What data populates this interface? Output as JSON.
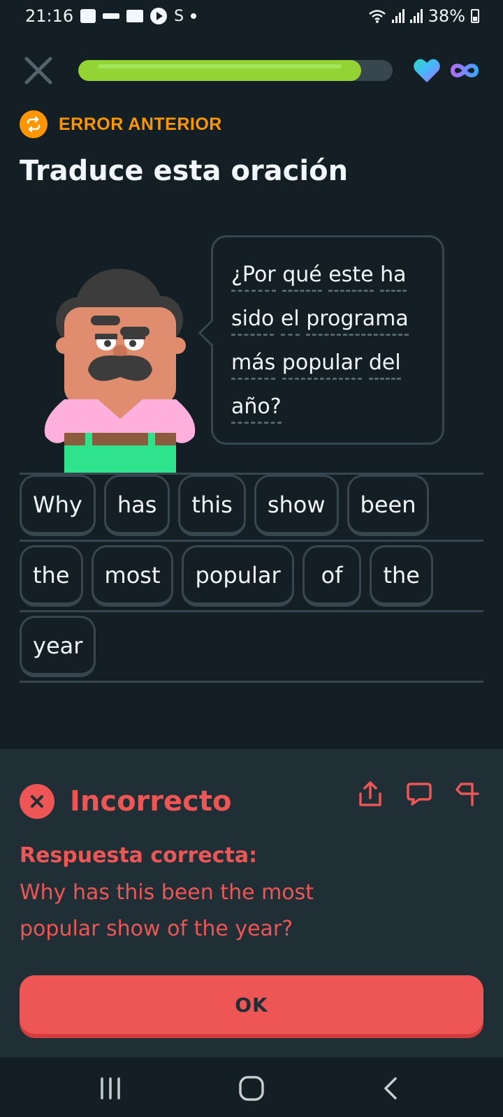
{
  "status_bar": {
    "time": "21:16",
    "battery": "38%",
    "icons": [
      "message-icon",
      "app-icon",
      "folder-icon",
      "play-icon",
      "shazam-icon",
      "dot-icon",
      "wifi-icon",
      "signal-icon",
      "battery-icon"
    ]
  },
  "lesson": {
    "progress": 0.9,
    "hearts": "heart-icon",
    "lives": "infinity-icon",
    "colors": {
      "progress": "#93d333",
      "track": "#37464f"
    }
  },
  "header": {
    "badge": "ERROR ANTERIOR",
    "title": "Traduce esta oración"
  },
  "prompt": {
    "lines": [
      [
        "¿Por",
        "qué",
        "este",
        "ha"
      ],
      [
        "sido",
        "el",
        "programa"
      ],
      [
        "más",
        "popular",
        "del"
      ],
      [
        "año?"
      ]
    ]
  },
  "answer": {
    "rows": [
      [
        "Why",
        "has",
        "this",
        "show",
        "been"
      ],
      [
        "the",
        "most",
        "popular",
        "of",
        "the"
      ],
      [
        "year"
      ]
    ]
  },
  "feedback": {
    "title": "Incorrecto",
    "label": "Respuesta correcta:",
    "answer": "Why has this been the most popular show of the year?",
    "button": "OK",
    "actions": [
      "share-icon",
      "comment-icon",
      "flag-icon"
    ],
    "colors": {
      "error": "#ee5555",
      "panel": "#202f36"
    }
  },
  "nav_bar": {
    "buttons": [
      "recent-apps-icon",
      "home-icon",
      "back-icon"
    ]
  }
}
